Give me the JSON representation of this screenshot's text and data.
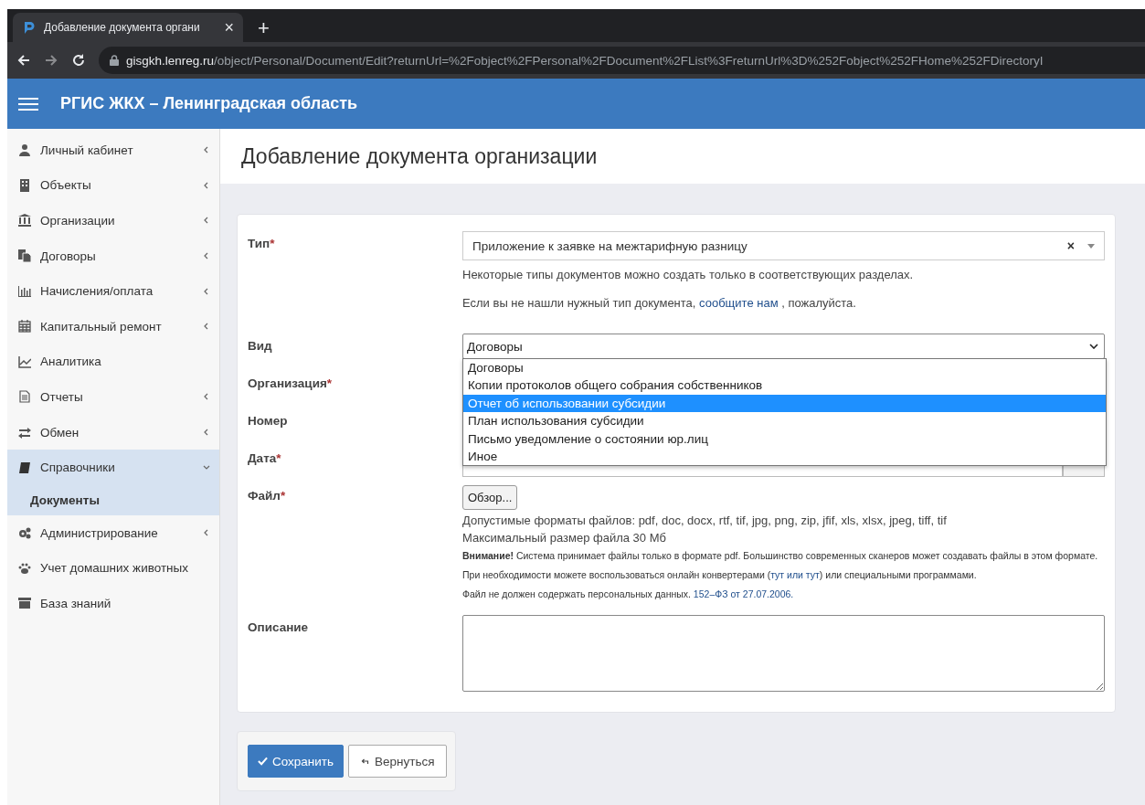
{
  "browser": {
    "tab_title": "Добавление документа органи",
    "tab_close": "×",
    "new_tab": "+",
    "url_host": "gisgkh.lenreg.ru",
    "url_path": "/object/Personal/Document/Edit?returnUrl=%2Fobject%2FPersonal%2FDocument%2FList%3FreturnUrl%3D%252Fobject%252FHome%252FDirectoryI"
  },
  "header": {
    "title": "РГИС ЖКХ – Ленинградская область"
  },
  "sidebar": {
    "items": [
      {
        "label": "Личный кабинет",
        "has_children": true,
        "expanded": false
      },
      {
        "label": "Объекты",
        "has_children": true,
        "expanded": false
      },
      {
        "label": "Организации",
        "has_children": true,
        "expanded": false
      },
      {
        "label": "Договоры",
        "has_children": true,
        "expanded": false
      },
      {
        "label": "Начисления/оплата",
        "has_children": true,
        "expanded": false
      },
      {
        "label": "Капитальный ремонт",
        "has_children": true,
        "expanded": false
      },
      {
        "label": "Аналитика",
        "has_children": false,
        "expanded": false
      },
      {
        "label": "Отчеты",
        "has_children": true,
        "expanded": false
      },
      {
        "label": "Обмен",
        "has_children": true,
        "expanded": false
      },
      {
        "label": "Справочники",
        "has_children": true,
        "expanded": true,
        "children": [
          {
            "label": "Документы",
            "selected": true
          }
        ]
      },
      {
        "label": "Администрирование",
        "has_children": true,
        "expanded": false
      },
      {
        "label": "Учет домашних животных",
        "has_children": false,
        "expanded": false
      },
      {
        "label": "База знаний",
        "has_children": false,
        "expanded": false
      }
    ]
  },
  "page": {
    "title": "Добавление документа организации"
  },
  "form": {
    "type": {
      "label": "Тип",
      "mark": "*",
      "value": "Приложение к заявке на межтарифную разницу",
      "clear": "×",
      "hint": "Некоторые типы документов можно создать только в соответствующих разделах.",
      "hint2_before": "Если вы не нашли нужный тип документа,",
      "hint2_link": "сообщите нам",
      "hint2_after": ", пожалуйста."
    },
    "kind": {
      "label": "Вид",
      "value": "Договоры",
      "open": true,
      "options": [
        {
          "label": "Договоры",
          "highlighted": false
        },
        {
          "label": "Копии протоколов общего собрания собственников",
          "highlighted": false
        },
        {
          "label": "Отчет об использовании субсидии",
          "highlighted": true
        },
        {
          "label": "План использования субсидии",
          "highlighted": false
        },
        {
          "label": "Письмо уведомление о состоянии юр.лиц",
          "highlighted": false
        },
        {
          "label": "Иное",
          "highlighted": false
        }
      ]
    },
    "organization": {
      "label": "Организация",
      "mark": "*"
    },
    "number": {
      "label": "Номер"
    },
    "date": {
      "label": "Дата",
      "mark": "*"
    },
    "file": {
      "label": "Файл",
      "mark": "*",
      "button": "Обзор...",
      "formats": "Допустимые форматы файлов: pdf, doc, docx, rtf, tif, jpg, png, zip, jfif, xls, xlsx, jpeg, tiff, tif",
      "max_size": "Максимальный размер файла 30 Мб",
      "warning_before": "**Внимание!** Система принимает файлы только в формате pdf. Большинство современных сканеров может создавать файлы в этом формате. При необходимости можете воспользоваться онлайн конвертерами (",
      "warning_link": "тут или тут",
      "warning_after": ") или специальными программами.",
      "note_before": "Файл не должен содержать персональных данных.",
      "note_link": "152–ФЗ от 27.07.2006."
    },
    "description": {
      "label": "Описание"
    }
  },
  "buttons": {
    "save": "Сохранить",
    "back": "Вернуться"
  }
}
